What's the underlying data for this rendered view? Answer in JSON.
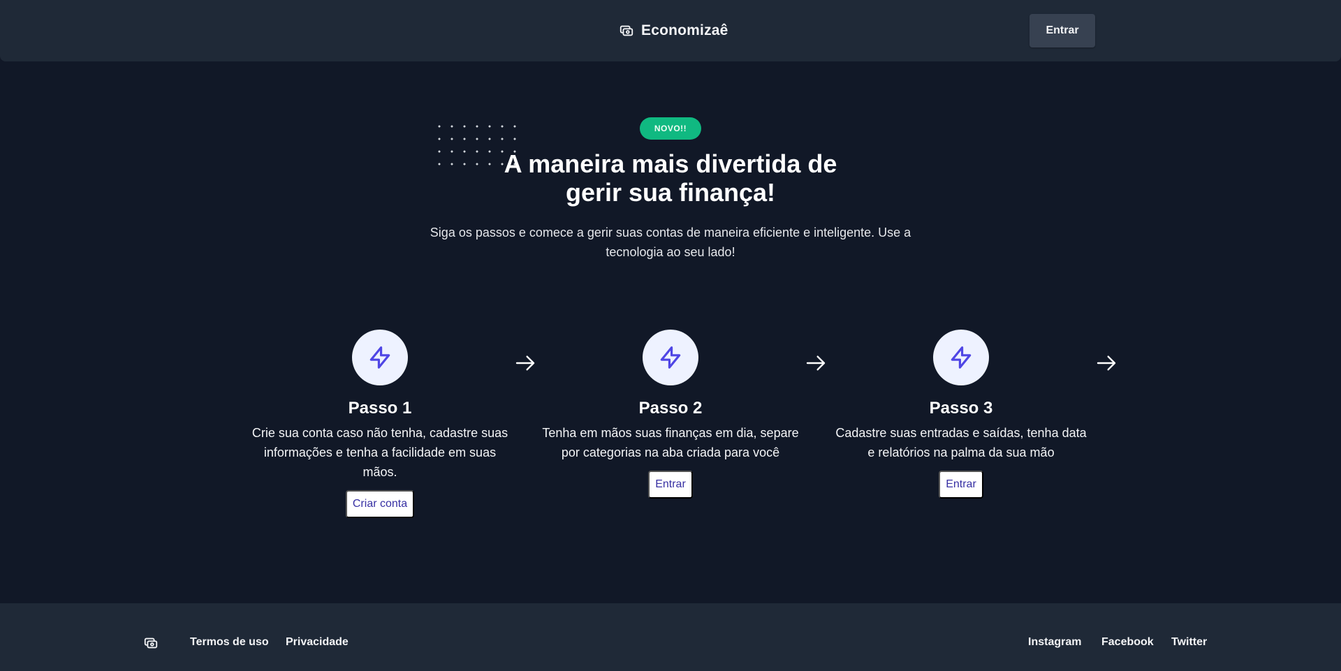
{
  "header": {
    "brand_icon": "cash-icon",
    "brand_name": "Economizaê",
    "login_label": "Entrar"
  },
  "hero": {
    "badge": "NOVO!!",
    "title_line1": "A maneira mais divertida de",
    "title_line2": "gerir sua finança!",
    "subtitle_line1": "Siga os passos e comece a gerir suas contas de maneira eficiente e inteligente. Use a",
    "subtitle_line2": "tecnologia ao seu lado!"
  },
  "steps": [
    {
      "icon": "lightning-bolt-icon",
      "title": "Passo 1",
      "description": "Crie sua conta caso não tenha, cadastre suas informações e tenha a facilidade em suas mãos.",
      "button": "Criar conta"
    },
    {
      "icon": "lightning-bolt-icon",
      "title": "Passo 2",
      "description": "Tenha em mãos suas finanças em dia, separe por categorias na aba criada para você",
      "button": "Entrar"
    },
    {
      "icon": "lightning-bolt-icon",
      "title": "Passo 3",
      "description": "Cadastre suas entradas e saídas, tenha data e relatórios na palma da sua mão",
      "button": "Entrar"
    }
  ],
  "footer": {
    "logo_icon": "cash-icon",
    "links_left": [
      "Termos de uso",
      "Privacidade"
    ],
    "links_right": [
      "Instagram",
      "Facebook",
      "Twitter"
    ]
  },
  "colors": {
    "background": "#111827",
    "surface": "#1f2937",
    "badge": "#10b981",
    "accent": "#4f46e5",
    "icon_circle": "#eef2ff"
  }
}
